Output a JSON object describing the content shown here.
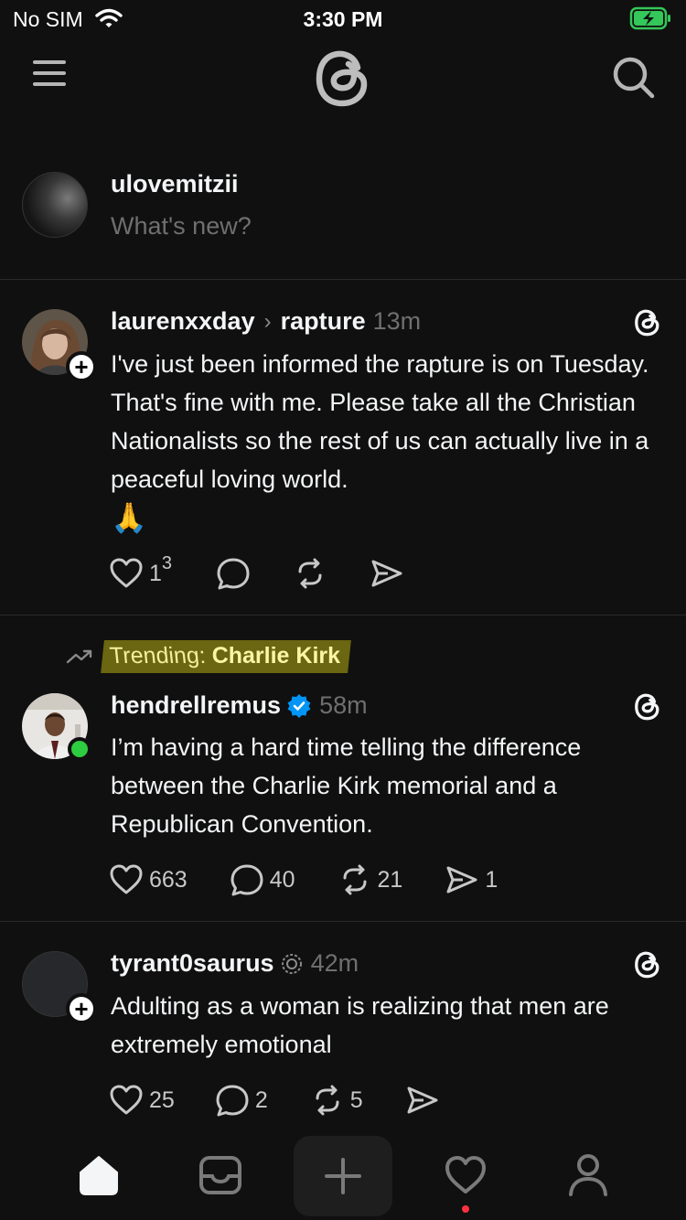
{
  "status_bar": {
    "carrier": "No SIM",
    "time": "3:30 PM",
    "battery_color": "#34c759"
  },
  "composer": {
    "username": "ulovemitzii",
    "placeholder": "What's new?"
  },
  "posts": [
    {
      "username": "laurenxxday",
      "topic": "rapture",
      "time": "13m",
      "text": "I've just been informed the rapture is on Tuesday. That's fine with me. Please take all the Christian Nationalists so the rest of us can actually live in a peaceful loving world.",
      "emoji": "🙏",
      "likes": "1",
      "likes_sup": "3",
      "comments": "",
      "reposts": "",
      "shares": ""
    },
    {
      "trending_label": "Trending:",
      "trending_topic": "Charlie Kirk",
      "username": "hendrellremus",
      "verified": true,
      "time": "58m",
      "text": "I’m having a hard time telling the difference between the Charlie Kirk memorial and a Republican Convention.",
      "likes": "663",
      "comments": "40",
      "reposts": "21",
      "shares": "1"
    },
    {
      "username": "tyrant0saurus",
      "time": "42m",
      "text": "Adulting as a woman is realizing that men are extremely emotional",
      "likes": "25",
      "comments": "2",
      "reposts": "5",
      "shares": ""
    }
  ],
  "icons": {
    "menu": "menu-icon",
    "logo": "threads-logo-icon",
    "search": "search-icon",
    "home": "home-icon",
    "inbox": "inbox-icon",
    "compose": "plus-icon",
    "activity": "heart-icon",
    "profile": "person-icon"
  },
  "colors": {
    "background": "#101010",
    "verified": "#0095f6",
    "online": "#2ecc40",
    "trend_highlight": "#6a6611",
    "notification": "#ff3040"
  }
}
